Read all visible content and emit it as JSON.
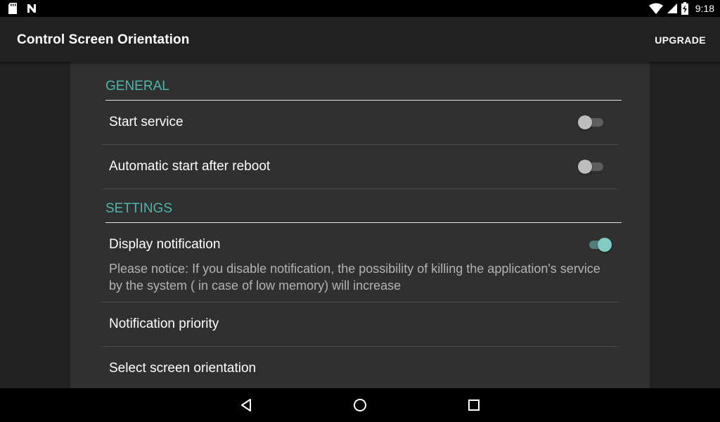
{
  "status_bar": {
    "time": "9:18",
    "left_icons": [
      "sd-card-icon",
      "n-notification-icon"
    ],
    "right_icons": [
      "wifi-icon",
      "signal-icon",
      "battery-icon"
    ]
  },
  "app_bar": {
    "title": "Control Screen Orientation",
    "action": "UPGRADE"
  },
  "sections": {
    "general": {
      "header": "GENERAL",
      "start_service": {
        "title": "Start service",
        "enabled": false
      },
      "auto_start": {
        "title": "Automatic start after reboot",
        "enabled": false
      }
    },
    "settings": {
      "header": "SETTINGS",
      "display_notification": {
        "title": "Display notification",
        "summary": "Please notice: If you disable notification, the possibility of killing the application's service by the system ( in case of low memory) will increase",
        "enabled": true
      },
      "notification_priority": {
        "title": "Notification priority"
      },
      "select_orientation": {
        "title": "Select screen orientation"
      }
    }
  },
  "colors": {
    "accent": "#4db6ac",
    "background": "#212121",
    "panel": "#303030"
  },
  "nav_bar": {
    "buttons": [
      "back-icon",
      "home-icon",
      "recents-icon"
    ]
  }
}
